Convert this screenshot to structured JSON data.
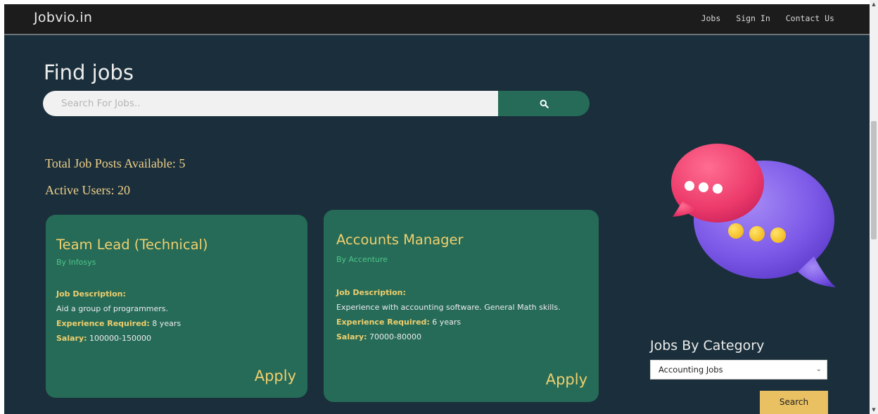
{
  "navbar": {
    "brand": "Jobvio.in",
    "links": [
      "Jobs",
      "Sign In",
      "Contact Us"
    ]
  },
  "hero": {
    "title": "Find jobs",
    "search_placeholder": "Search For Jobs.."
  },
  "stats": {
    "total_jobs": "Total Job Posts Available: 5",
    "active_users": "Active Users: 20"
  },
  "jobs": [
    {
      "title": "Team Lead (Technical)",
      "company": "By Infosys",
      "desc_label": "Job Description:",
      "description": "Aid a group of programmers.",
      "exp_label": "Experience Required:",
      "experience": " 8 years",
      "salary_label": "Salary:",
      "salary": " 100000-150000",
      "apply": "Apply"
    },
    {
      "title": "Accounts Manager",
      "company": "By Accenture",
      "desc_label": "Job Description:",
      "description": "Experience with accounting software. General Math skills.",
      "exp_label": "Experience Required:",
      "experience": " 6 years",
      "salary_label": "Salary:",
      "salary": " 70000-80000",
      "apply": "Apply"
    }
  ],
  "category": {
    "title": "Jobs By Category",
    "selected": "Accounting Jobs",
    "search_label": "Search"
  },
  "icons": {
    "search": "search-icon",
    "select": "chevron-down-icon",
    "illustration": "chat-bubbles-icon"
  },
  "colors": {
    "background": "#1a2f3b",
    "navbar": "#1c1c1c",
    "card": "#266b57",
    "accent": "#f0cf6e",
    "company": "#4fc58a",
    "search_button": "#266b57",
    "category_button": "#e9c062"
  }
}
